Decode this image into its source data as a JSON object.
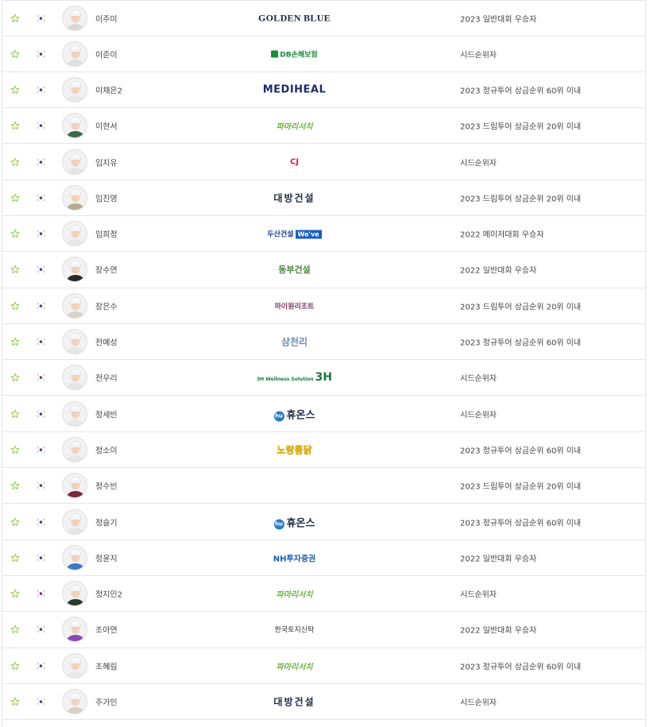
{
  "rows": [
    {
      "name": "이주미",
      "sponsor": "GOLDEN BLUE",
      "sponsor_style": "goldenblue",
      "qualification": "2023 일반대회 우승자",
      "avatar_color": "#d9d9d9"
    },
    {
      "name": "이준이",
      "sponsor": "DB손해보험",
      "sponsor_style": "db",
      "qualification": "시드순위자",
      "avatar_color": "#e0e0e0"
    },
    {
      "name": "이채은2",
      "sponsor": "MEDIHEAL",
      "sponsor_style": "mediheal",
      "qualification": "2023 정규투어 상금순위 60위 이내",
      "avatar_color": "#e8e8e8"
    },
    {
      "name": "이현서",
      "sponsor": "파마리서치",
      "sponsor_style": "pharma",
      "qualification": "2023 드림투어 상금순위 20위 이내",
      "avatar_color": "#3c6a4a"
    },
    {
      "name": "임지유",
      "sponsor": "CJ",
      "sponsor_style": "cj",
      "qualification": "시드순위자",
      "avatar_color": "#e6e6e6"
    },
    {
      "name": "임진영",
      "sponsor": "대방건설",
      "sponsor_style": "daebang",
      "qualification": "2023 드림투어 상금순위 20위 이내",
      "avatar_color": "#b8a890"
    },
    {
      "name": "임희정",
      "sponsor": "두산건설",
      "sponsor_badge": "We've",
      "sponsor_style": "doosan",
      "qualification": "2022 메이저대회 우승자",
      "avatar_color": "#e8e8e8"
    },
    {
      "name": "장수연",
      "sponsor": "동부건설",
      "sponsor_style": "dongbu",
      "qualification": "2022 일반대회 우승자",
      "avatar_color": "#2a2a2a"
    },
    {
      "name": "장은수",
      "sponsor": "하이원리조트",
      "sponsor_style": "high",
      "qualification": "2023 드림투어 상금순위 20위 이내",
      "avatar_color": "#d8d2c8"
    },
    {
      "name": "전예성",
      "sponsor": "삼천리",
      "sponsor_style": "samch",
      "qualification": "2023 정규투어 상금순위 60위 이내",
      "avatar_color": "#e6e6e6"
    },
    {
      "name": "전우리",
      "sponsor": "3H",
      "sponsor_prefix": "3H Wellness Solution",
      "sponsor_style": "3h",
      "qualification": "시드순위자",
      "avatar_color": "#e4e4e4"
    },
    {
      "name": "정세빈",
      "sponsor": "휴온스",
      "sponsor_style": "hu",
      "qualification": "시드순위자",
      "avatar_color": "#e8e8e8"
    },
    {
      "name": "정소이",
      "sponsor": "노랑통닭",
      "sponsor_style": "nohwa",
      "qualification": "2023 정규투어 상금순위 60위 이내",
      "avatar_color": "#e6e6e6"
    },
    {
      "name": "정수빈",
      "sponsor": "",
      "sponsor_style": "none",
      "qualification": "2023 드림투어 상금순위 20위 이내",
      "avatar_color": "#7a2a3a"
    },
    {
      "name": "정슬기",
      "sponsor": "휴온스",
      "sponsor_style": "hu",
      "qualification": "2023 정규투어 상금순위 60위 이내",
      "avatar_color": "#e6e6e6"
    },
    {
      "name": "정윤지",
      "sponsor": "NH투자증권",
      "sponsor_style": "nh",
      "qualification": "2022 일반대회 우승자",
      "avatar_color": "#3a7ac0"
    },
    {
      "name": "정지민2",
      "sponsor": "파마리서치",
      "sponsor_style": "pharma",
      "qualification": "시드순위자",
      "avatar_color": "#2a3a2a"
    },
    {
      "name": "조아연",
      "sponsor": "한국토지신탁",
      "sponsor_style": "lh",
      "qualification": "2022 일반대회 우승자",
      "avatar_color": "#8a4ab0"
    },
    {
      "name": "조혜림",
      "sponsor": "파마리서치",
      "sponsor_style": "pharma",
      "qualification": "2023 정규투어 상금순위 60위 이내",
      "avatar_color": "#e8e8e8"
    },
    {
      "name": "주가인",
      "sponsor": "대방건설",
      "sponsor_style": "daebang",
      "qualification": "시드순위자",
      "avatar_color": "#d8d0c4"
    }
  ],
  "colors": {
    "star": "#8fd14f",
    "flag_red": "#cd2e3a",
    "flag_blue": "#0047a0",
    "border": "#e6e6e6"
  }
}
